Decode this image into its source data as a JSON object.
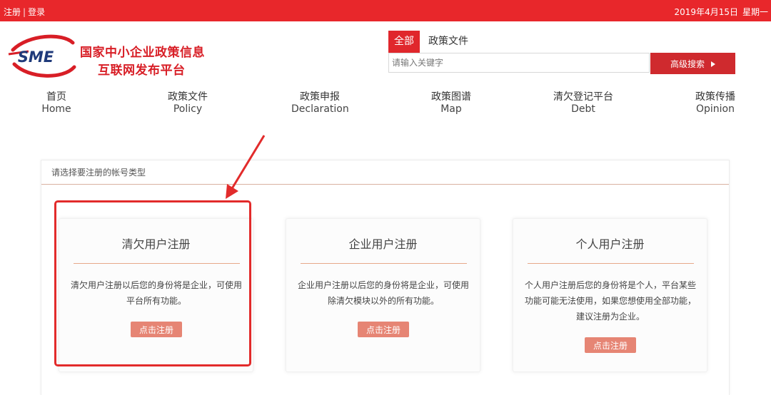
{
  "topbar": {
    "register": "注册",
    "separator": "|",
    "login": "登录",
    "date": "2019年4月15日",
    "weekday": "星期一"
  },
  "logo": {
    "mark": "SME",
    "line1": "国家中小企业政策信息",
    "line2": "互联网发布平台"
  },
  "search": {
    "tab_all": "全部",
    "tab_policy": "政策文件",
    "placeholder": "请输入关键字",
    "button": "高级搜索"
  },
  "nav": [
    {
      "zh": "首页",
      "en": "Home"
    },
    {
      "zh": "政策文件",
      "en": "Policy"
    },
    {
      "zh": "政策申报",
      "en": "Declaration"
    },
    {
      "zh": "政策图谱",
      "en": "Map"
    },
    {
      "zh": "清欠登记平台",
      "en": "Debt"
    },
    {
      "zh": "政策传播",
      "en": "Opinion"
    }
  ],
  "panel": {
    "heading": "请选择要注册的帐号类型"
  },
  "cards": [
    {
      "title": "清欠用户注册",
      "desc": "清欠用户注册以后您的身份将是企业，可使用平台所有功能。",
      "button": "点击注册"
    },
    {
      "title": "企业用户注册",
      "desc": "企业用户注册以后您的身份将是企业，可使用除清欠模块以外的所有功能。",
      "button": "点击注册"
    },
    {
      "title": "个人用户注册",
      "desc": "个人用户注册后您的身份将是个人，平台某些功能可能无法使用，如果您想使用全部功能，建议注册为企业。",
      "button": "点击注册"
    }
  ],
  "colors": {
    "brand_red": "#e8272b",
    "button_salmon": "#e68574",
    "annotation_red": "#e22b2b"
  }
}
